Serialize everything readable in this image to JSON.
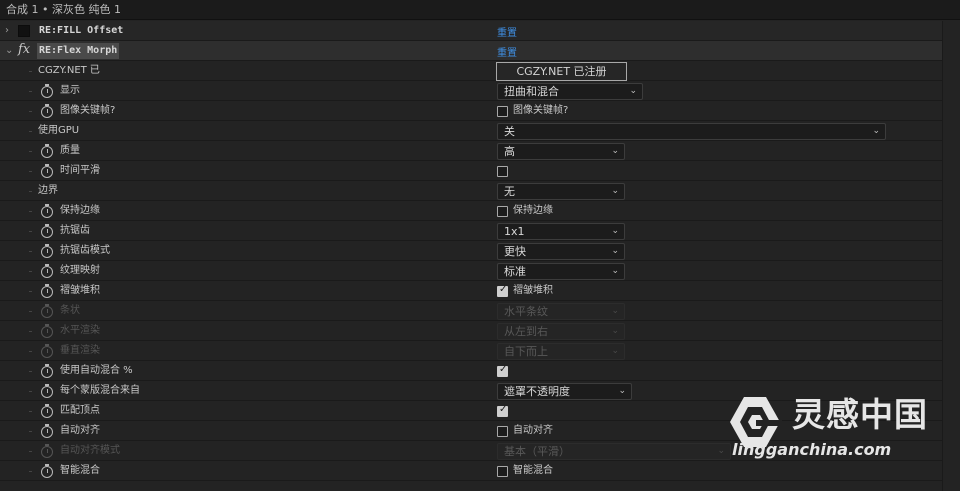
{
  "window": {
    "title": "合成 1 • 深灰色 纯色 1"
  },
  "effects": [
    {
      "name": "RE:FILL Offset",
      "reset": "重置",
      "expanded": false
    },
    {
      "name": "RE:Flex Morph",
      "reset": "重置",
      "expanded": true
    }
  ],
  "flex": {
    "cgzy_label": "CGZY.NET 已",
    "register_button": "CGZY.NET 已注册",
    "display": {
      "label": "显示",
      "value": "扭曲和混合"
    },
    "image_keyframe": {
      "label": "图像关键帧?",
      "checkbox": "图像关键帧?"
    },
    "use_gpu": {
      "label": "使用GPU",
      "value": "关"
    },
    "quality": {
      "label": "质量",
      "value": "高"
    },
    "time_smooth": {
      "label": "时间平滑"
    },
    "border": {
      "label": "边界",
      "value": "无"
    },
    "keep_border": {
      "label": "保持边缘",
      "checkbox": "保持边缘"
    },
    "antialias": {
      "label": "抗锯齿",
      "value": "1x1"
    },
    "antialias_mode": {
      "label": "抗锯齿模式",
      "value": "更快"
    },
    "texture_map": {
      "label": "纹理映射",
      "value": "标准"
    },
    "stack_layers": {
      "label": "褶皱堆积",
      "checkbox": "褶皱堆积"
    },
    "stripes": {
      "label": "条状",
      "value": "水平条纹"
    },
    "horizontal_render": {
      "label": "水平渲染",
      "value": "从左到右"
    },
    "vertical_render": {
      "label": "垂直渲染",
      "value": "自下而上"
    },
    "auto_blend": {
      "label": "使用自动混合 %"
    },
    "blend_from": {
      "label": "每个蒙版混合来自",
      "value": "遮罩不透明度"
    },
    "match_vertices": {
      "label": "匹配顶点"
    },
    "auto_align": {
      "label": "自动对齐",
      "checkbox": "自动对齐"
    },
    "auto_align_mode": {
      "label": "自动对齐模式",
      "value": "基本（平滑）"
    },
    "smart_blend": {
      "label": "智能混合",
      "checkbox": "智能混合"
    }
  },
  "watermark": {
    "brand_cn": "灵感中国",
    "brand_en": "lingganchina.com"
  },
  "colors": {
    "link": "#3f8fe3",
    "background": "#232323"
  }
}
